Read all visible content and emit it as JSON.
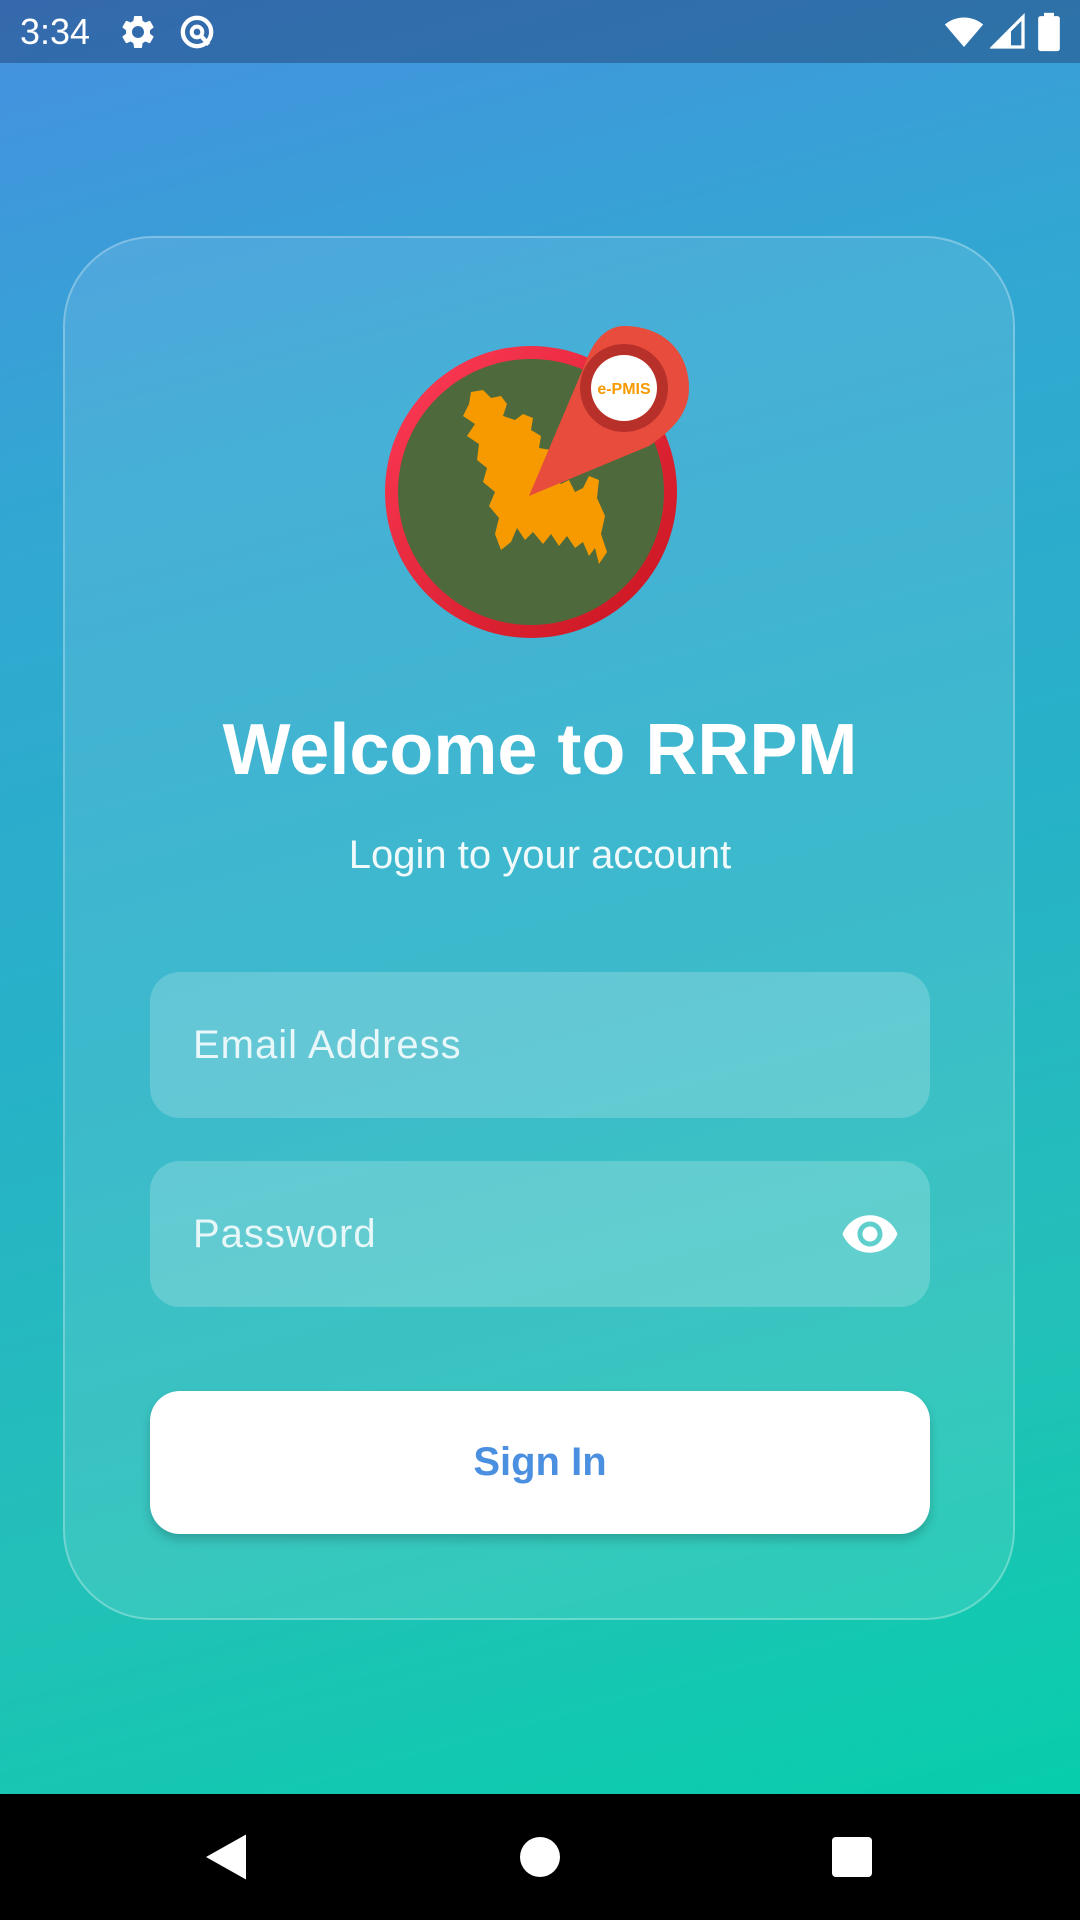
{
  "status_bar": {
    "time": "3:34",
    "icons": [
      "settings-icon",
      "data-saver-icon",
      "wifi-icon",
      "signal-icon",
      "battery-icon"
    ]
  },
  "logo": {
    "badge_text": "e-PMIS",
    "icon": "bangladesh-map-location-pin-logo"
  },
  "login": {
    "title": "Welcome to RRPM",
    "subtitle": "Login to your account",
    "email_placeholder": "Email Address",
    "password_placeholder": "Password",
    "sign_in_label": "Sign In"
  },
  "nav_bar": {
    "icons": [
      "back-icon",
      "home-icon",
      "recents-icon"
    ]
  },
  "colors": {
    "gradient_top": "#4690e0",
    "gradient_bottom": "#00d1a8",
    "button_text": "#4a8fe0",
    "logo_ring": "#e8253b",
    "logo_fill": "#4e6a3c",
    "logo_map": "#f79a00",
    "logo_pin": "#e74c3c"
  }
}
